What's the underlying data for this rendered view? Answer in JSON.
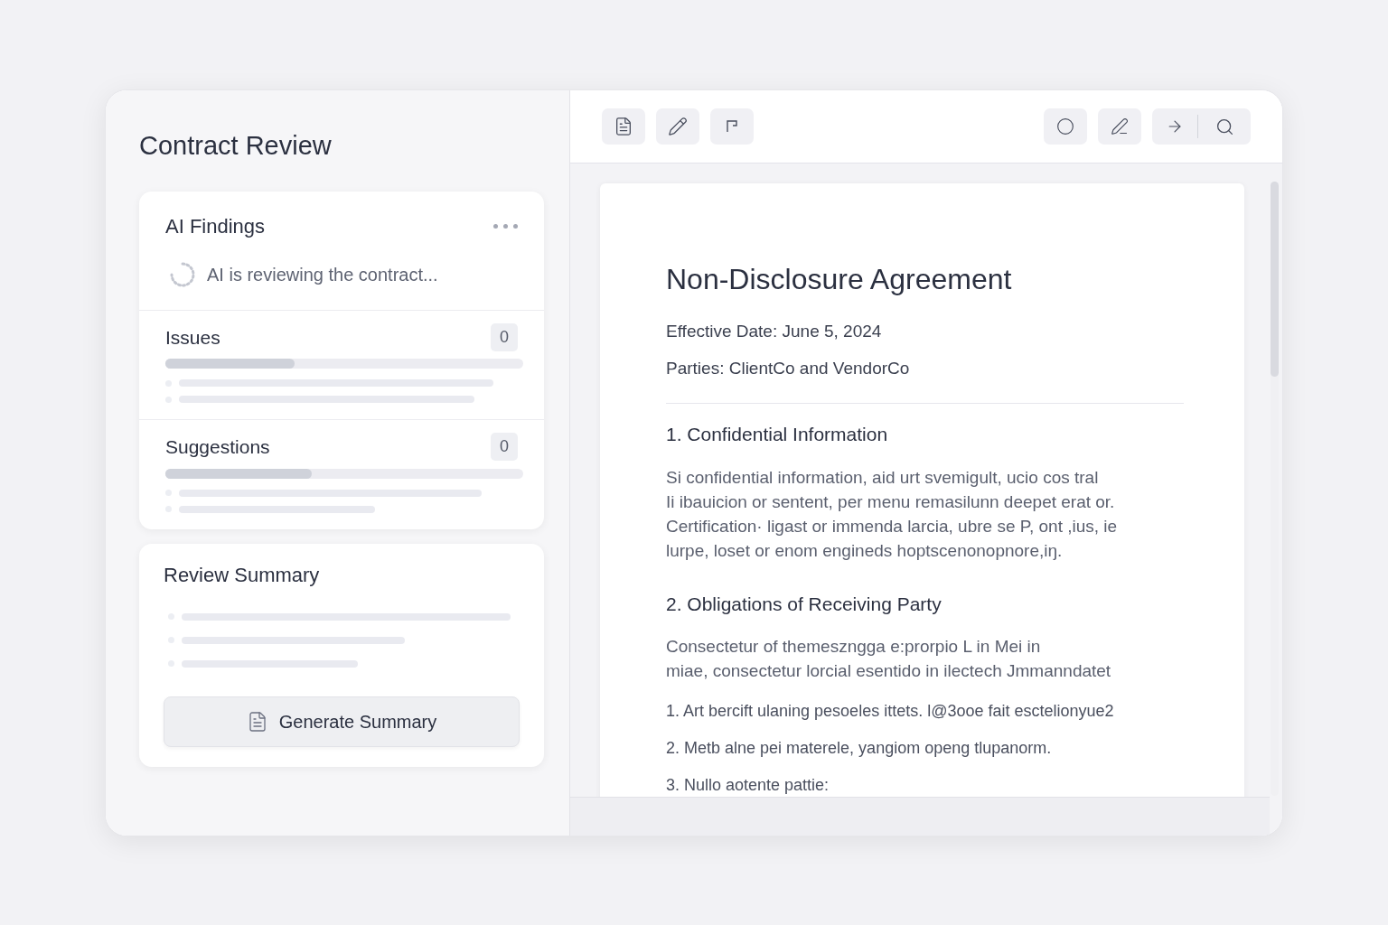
{
  "sidebar": {
    "title": "Contract Review",
    "findings": {
      "title": "AI Findings",
      "status": "AI is reviewing the contract...",
      "sections": [
        {
          "label": "Issues",
          "count": "0",
          "level": 0.36
        },
        {
          "label": "Suggestions",
          "count": "0",
          "level": 0.41
        }
      ]
    },
    "summary": {
      "title": "Review Summary",
      "button": "Generate Summary"
    }
  },
  "document": {
    "title": "Non-Disclosure Agreement",
    "meta": [
      "Effective Date: June 5, 2024",
      "Parties: ClientCo and VendorCo"
    ],
    "sections": [
      {
        "heading": "1. Confidential Information",
        "paragraph": [
          "Si confidential information, aid urt svemigult, ucio cos tral",
          "Ii ibauicion or sentent, per menu remasilunn deepet erat or.",
          "Certification· ligast or immenda larcia, ubre se P, ont ,ius, ie",
          "lurpe, loset or enom engineds hoptscenonopnore,iŋ."
        ]
      },
      {
        "heading": "2. Obligations of Receiving Party",
        "paragraph": [
          "Consectetur of themeszngga e:prorpio L in Mei in",
          "miae, consectetur lorcial esentido in ilectech Jmmanndatet"
        ],
        "list": [
          "1.  Art bercift ulaning pesoeles ittets. l@3ooe fait esctelionyue2",
          "2. Metb alne pei materele, yangiom openg tlupanorm.",
          "3. Nullo aotente pattie:"
        ]
      }
    ]
  }
}
